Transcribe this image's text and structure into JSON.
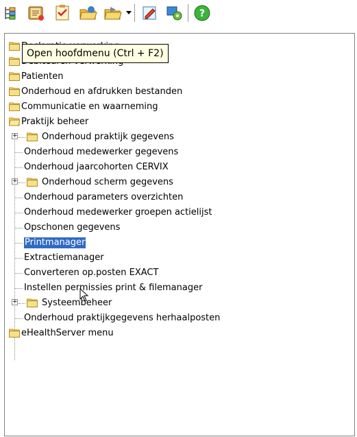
{
  "toolbar": {
    "items": [
      {
        "name": "main-menu-tree-icon"
      },
      {
        "name": "book-icon"
      },
      {
        "name": "checklist-icon"
      },
      {
        "name": "open-folder-icon"
      },
      {
        "name": "open-folder-dropdown-icon"
      },
      {
        "name": "edit-pencil-icon"
      },
      {
        "name": "settings-gear-icon"
      },
      {
        "name": "help-icon"
      }
    ],
    "help_glyph": "?"
  },
  "tooltip": {
    "text": "Open hoofdmenu (Ctrl + F2)"
  },
  "tree": {
    "items": [
      {
        "label": "Declaratie verwerking",
        "level": 0,
        "folder": true
      },
      {
        "label": "Debiteuren verwerking",
        "level": 0,
        "folder": true
      },
      {
        "label": "Patienten",
        "level": 0,
        "folder": true
      },
      {
        "label": "Onderhoud en afdrukken bestanden",
        "level": 0,
        "folder": true
      },
      {
        "label": "Communicatie en waarneming",
        "level": 0,
        "folder": true
      },
      {
        "label": "Praktijk beheer",
        "level": 0,
        "folder": true,
        "open": true
      },
      {
        "label": "Onderhoud praktijk gegevens",
        "level": 1,
        "folder": true,
        "expander": "+"
      },
      {
        "label": "Onderhoud medewerker gegevens",
        "level": 1
      },
      {
        "label": "Onderhoud jaarcohorten CERVIX",
        "level": 1
      },
      {
        "label": "Onderhoud scherm gegevens",
        "level": 1,
        "folder": true,
        "expander": "+"
      },
      {
        "label": "Onderhoud parameters overzichten",
        "level": 1
      },
      {
        "label": "Onderhoud medewerker groepen actielijst",
        "level": 1
      },
      {
        "label": "Opschonen gegevens",
        "level": 1
      },
      {
        "label": "Printmanager",
        "level": 1,
        "selected": true
      },
      {
        "label": "Extractiemanager",
        "level": 1
      },
      {
        "label": "Converteren op.posten EXACT",
        "level": 1
      },
      {
        "label": "Instellen permissies print & filemanager",
        "level": 1
      },
      {
        "label": "Systeembeheer",
        "level": 1,
        "folder": true,
        "expander": "+"
      },
      {
        "label": "Onderhoud praktijkgegevens herhaalposten",
        "level": 1
      },
      {
        "label": "eHealthServer menu",
        "level": 0,
        "folder": true
      }
    ]
  }
}
